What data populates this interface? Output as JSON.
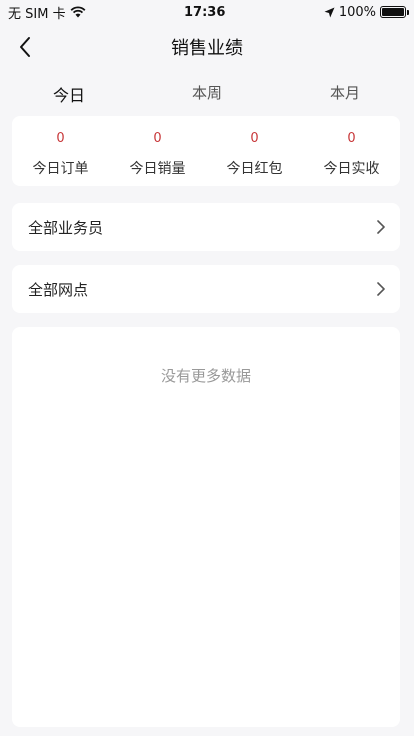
{
  "status": {
    "carrier": "无 SIM 卡",
    "time": "17:36",
    "battery": "100%"
  },
  "nav": {
    "title": "销售业绩"
  },
  "tabs": [
    {
      "label": "今日"
    },
    {
      "label": "本周"
    },
    {
      "label": "本月"
    }
  ],
  "stats": [
    {
      "value": "0",
      "label": "今日订单"
    },
    {
      "value": "0",
      "label": "今日销量"
    },
    {
      "value": "0",
      "label": "今日红包"
    },
    {
      "value": "0",
      "label": "今日实收"
    }
  ],
  "filters": {
    "salesperson": "全部业务员",
    "outlet": "全部网点"
  },
  "empty_text": "没有更多数据",
  "colors": {
    "accent_value": "#c8383a",
    "tab_indicator": "#8fe0a8"
  }
}
